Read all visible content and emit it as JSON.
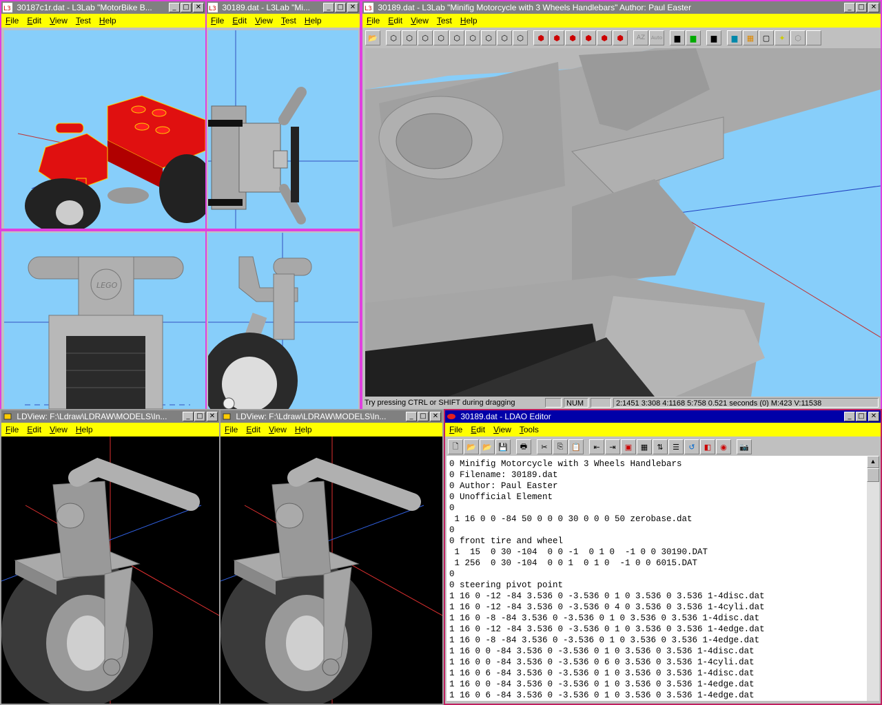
{
  "colors": {
    "menubar": "#ffff00",
    "sky": "#87cefa",
    "titlebar_active": "#0000a8",
    "titlebar_inactive": "#808080",
    "window_border": "#e040e0"
  },
  "l3lab_small_1": {
    "title": "30187c1r.dat - L3Lab  \"MotorBike B...",
    "menu": [
      "File",
      "Edit",
      "View",
      "Test",
      "Help"
    ]
  },
  "l3lab_small_2": {
    "title": "30189.dat - L3Lab  \"Mi...",
    "menu": [
      "File",
      "Edit",
      "View",
      "Test",
      "Help"
    ]
  },
  "l3lab_main": {
    "title": "30189.dat - L3Lab  \"Minifig Motorcycle with 3 Wheels Handlebars\"  Author: Paul Easter",
    "menu": [
      "File",
      "Edit",
      "View",
      "Test",
      "Help"
    ],
    "status": {
      "hint": "Try pressing CTRL or SHIFT during dragging",
      "num": "NUM",
      "stats": "2:1451 3:308 4:1168 5:758 0.521 seconds (0) M:423 V:11538"
    }
  },
  "ldview_1": {
    "title": "LDView: F:\\Ldraw\\LDRAW\\MODELS\\In...",
    "menu": [
      "File",
      "Edit",
      "View",
      "Help"
    ]
  },
  "ldview_2": {
    "title": "LDView: F:\\Ldraw\\LDRAW\\MODELS\\In...",
    "menu": [
      "File",
      "Edit",
      "View",
      "Help"
    ]
  },
  "ldao": {
    "title": "30189.dat - LDAO Editor",
    "menu": [
      "File",
      "Edit",
      "View",
      "Tools"
    ],
    "lines": [
      "0 Minifig Motorcycle with 3 Wheels Handlebars",
      "0 Filename: 30189.dat",
      "0 Author: Paul Easter",
      "0 Unofficial Element",
      "0",
      " 1 16 0 0 -84 50 0 0 0 30 0 0 0 50 zerobase.dat",
      "0",
      "0 front tire and wheel",
      " 1  15  0 30 -104  0 0 -1  0 1 0  -1 0 0 30190.DAT",
      " 1 256  0 30 -104  0 0 1  0 1 0  -1 0 0 6015.DAT",
      "0",
      "0 steering pivot point",
      "1 16 0 -12 -84 3.536 0 -3.536 0 1 0 3.536 0 3.536 1-4disc.dat",
      "1 16 0 -12 -84 3.536 0 -3.536 0 4 0 3.536 0 3.536 1-4cyli.dat",
      "1 16 0 -8 -84 3.536 0 -3.536 0 1 0 3.536 0 3.536 1-4disc.dat",
      "1 16 0 -12 -84 3.536 0 -3.536 0 1 0 3.536 0 3.536 1-4edge.dat",
      "1 16 0 -8 -84 3.536 0 -3.536 0 1 0 3.536 0 3.536 1-4edge.dat",
      "1 16 0 0 -84 3.536 0 -3.536 0 1 0 3.536 0 3.536 1-4disc.dat",
      "1 16 0 0 -84 3.536 0 -3.536 0 6 0 3.536 0 3.536 1-4cyli.dat",
      "1 16 0 6 -84 3.536 0 -3.536 0 1 0 3.536 0 3.536 1-4disc.dat",
      "1 16 0 0 -84 3.536 0 -3.536 0 1 0 3.536 0 3.536 1-4edge.dat",
      "1 16 0 6 -84 3.536 0 -3.536 0 1 0 3.536 0 3.536 1-4edge.dat"
    ]
  }
}
